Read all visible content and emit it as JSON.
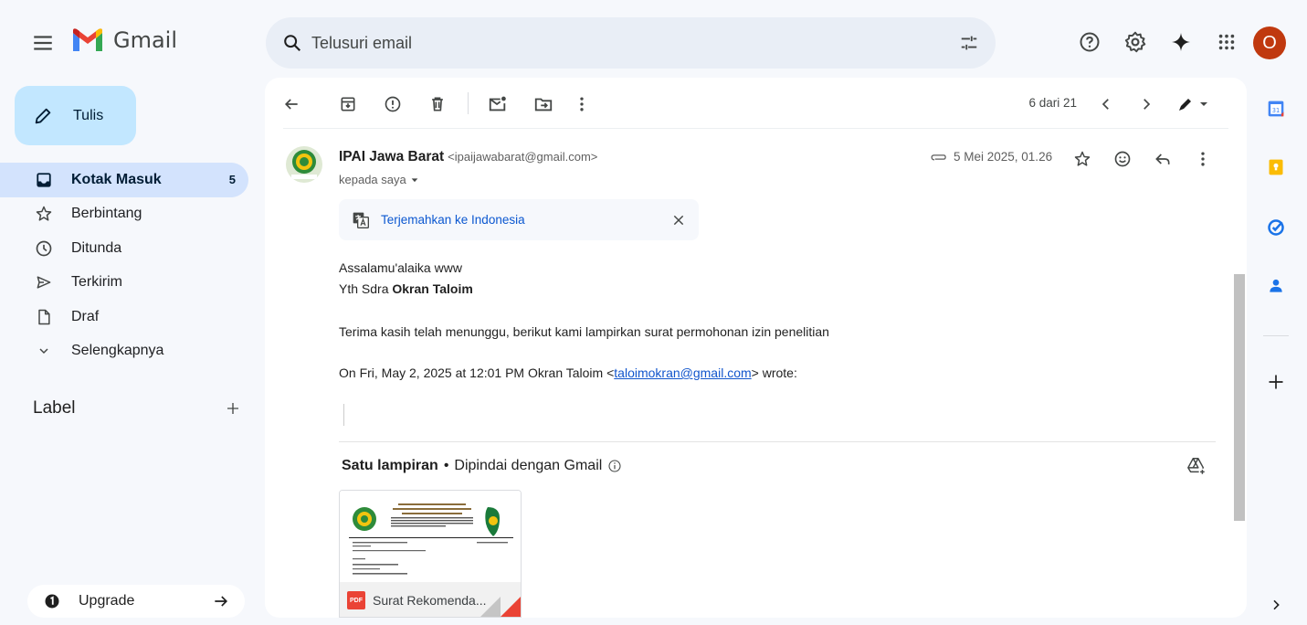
{
  "app": {
    "name": "Gmail"
  },
  "search": {
    "placeholder": "Telusuri email"
  },
  "user": {
    "avatar_letter": "O",
    "avatar_color": "#c0390f"
  },
  "compose": {
    "label": "Tulis"
  },
  "sidebar": {
    "items": [
      {
        "label": "Kotak Masuk",
        "count": "5",
        "icon": "inbox-icon",
        "active": true
      },
      {
        "label": "Berbintang",
        "count": "",
        "icon": "star-icon"
      },
      {
        "label": "Ditunda",
        "count": "",
        "icon": "clock-icon"
      },
      {
        "label": "Terkirim",
        "count": "",
        "icon": "send-icon"
      },
      {
        "label": "Draf",
        "count": "",
        "icon": "draft-icon"
      },
      {
        "label": "Selengkapnya",
        "count": "",
        "icon": "chevron-down-icon"
      }
    ],
    "label_heading": "Label",
    "upgrade_label": "Upgrade"
  },
  "toolbar": {
    "pager": "6 dari 21"
  },
  "message": {
    "sender_name": "IPAI Jawa Barat",
    "sender_email": "<ipaijawabarat@gmail.com>",
    "to": "kepada saya",
    "date": "5 Mei 2025, 01.26",
    "translate_label": "Terjemahkan ke Indonesia",
    "body": {
      "line1": "Assalamu'alaika www",
      "line2_prefix": "Yth Sdra ",
      "line2_name": "Okran Taloim",
      "line3": "Terima kasih telah menunggu, berikut kami lampirkan surat permohonan izin penelitian",
      "quote_prefix": "On Fri, May 2, 2025 at 12:01 PM Okran Taloim <",
      "quote_link": "taloimokran@gmail.com",
      "quote_suffix": "> wrote:"
    }
  },
  "attachments": {
    "heading": "Satu lampiran",
    "separator": "•",
    "scan_note": "Dipindai dengan Gmail",
    "file_name": "Surat Rekomenda...",
    "file_badge": "PDF"
  },
  "colors": {
    "accent": "#0b57d0",
    "compose_bg": "#c2e7ff",
    "active_nav": "#d3e3fd",
    "pdf_red": "#ea4335"
  }
}
